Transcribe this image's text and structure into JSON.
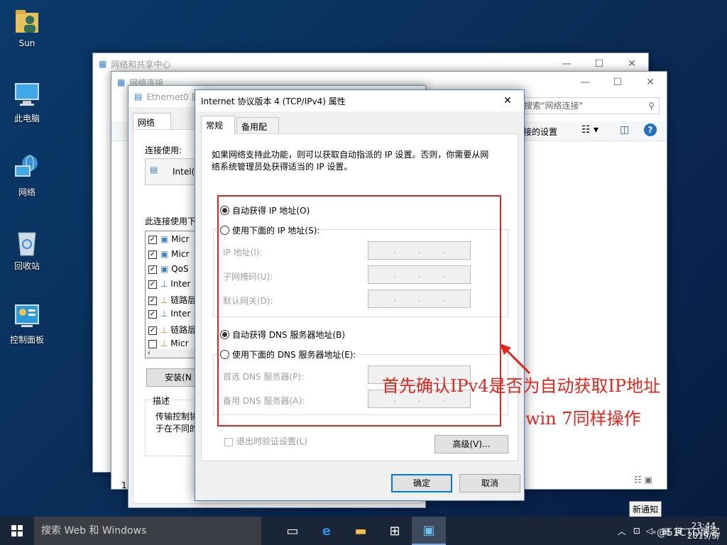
{
  "desktop": {
    "icons": [
      {
        "label": "Sun"
      },
      {
        "label": "此电脑"
      },
      {
        "label": "网络"
      },
      {
        "label": "回收站"
      },
      {
        "label": "控制面板"
      }
    ]
  },
  "windows": {
    "network_center": {
      "title": "网络和共享中心"
    },
    "network_connections": {
      "title": "网络连接",
      "search_placeholder": "搜索\"网络连接\"",
      "toolbar_label": "接的设置"
    },
    "ethernet_props": {
      "title": "Ethernet0 属",
      "tab": "网络",
      "connect_using_label": "连接使用:",
      "adapter_name": "Intel(R",
      "items_label": "此连接使用下",
      "items": [
        {
          "checked": true,
          "label": "Micr"
        },
        {
          "checked": true,
          "label": "Micr"
        },
        {
          "checked": true,
          "label": "QoS"
        },
        {
          "checked": true,
          "label": "Inter"
        },
        {
          "checked": true,
          "label": "链路层"
        },
        {
          "checked": true,
          "label": "Inter"
        },
        {
          "checked": true,
          "label": "链路层"
        },
        {
          "checked": false,
          "label": "Micr"
        }
      ],
      "install_button": "安装(N",
      "description_label": "描述",
      "description_text": [
        "传输控制协",
        "于在不同的"
      ],
      "footer_char": "1"
    }
  },
  "dialog": {
    "title": "Internet 协议版本 4 (TCP/IPv4) 属性",
    "close_glyph": "✕",
    "tabs": {
      "general": "常规",
      "alternate": "备用配置"
    },
    "intro": [
      "如果网络支持此功能，则可以获取自动指派的 IP 设置。否则，你需要从网",
      "络系统管理员处获得适当的 IP 设置。"
    ],
    "ip": {
      "auto_label": "自动获得 IP 地址(O)",
      "manual_label": "使用下面的 IP 地址(S):",
      "fields": [
        {
          "label": "IP 地址(I):"
        },
        {
          "label": "子网掩码(U):"
        },
        {
          "label": "默认网关(D):"
        }
      ]
    },
    "dns": {
      "auto_label": "自动获得 DNS 服务器地址(B)",
      "manual_label": "使用下面的 DNS 服务器地址(E):",
      "fields": [
        {
          "label": "首选 DNS 服务器(P):"
        },
        {
          "label": "备用 DNS 服务器(A):"
        }
      ]
    },
    "validate_label": "退出时验证设置(L)",
    "advanced_button": "高级(V)...",
    "ok_button": "确定",
    "cancel_button": "取消",
    "ip_dot": "."
  },
  "annotation": {
    "line1": "首先确认IPv4是否为自动获取IP地址",
    "line2": "win 7同样操作",
    "color": "#e0261d"
  },
  "taskbar": {
    "search_placeholder": "搜索 Web 和 Windows",
    "tooltip": "新通知",
    "time": "23:44",
    "date": "2019/5/",
    "ime": "英",
    "watermark": "@51CTO博客"
  }
}
